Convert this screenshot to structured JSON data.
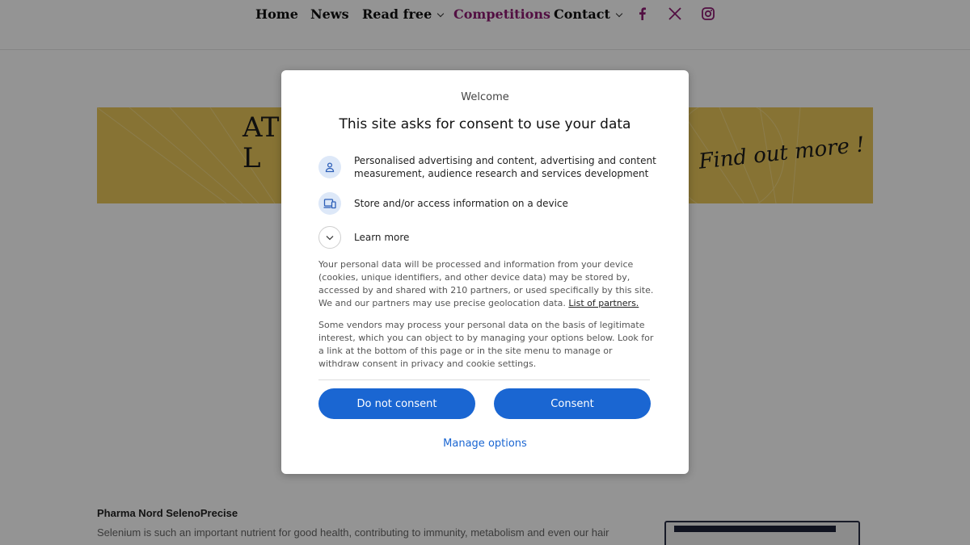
{
  "nav": {
    "items": [
      {
        "label": "Home"
      },
      {
        "label": "News"
      },
      {
        "label": "Read free"
      },
      {
        "label": "Competitions"
      },
      {
        "label": "Contact"
      }
    ],
    "social": [
      "facebook-icon",
      "x-icon",
      "instagram-icon"
    ],
    "active_color": "#8e1a73"
  },
  "banner": {
    "title": "AT\nL",
    "cta": "Find out more !",
    "color": "#e9c65a"
  },
  "article": {
    "title": "Pharma Nord SelenoPrecise",
    "body": "Selenium is such an important nutrient for good health, contributing to immunity, metabolism and even our hair"
  },
  "consent": {
    "welcome": "Welcome",
    "headline": "This site asks for consent to use your data",
    "purposes": [
      {
        "icon": "person-icon",
        "text": "Personalised advertising and content, advertising and content measurement, audience research and services development"
      },
      {
        "icon": "devices-icon",
        "text": "Store and/or access information on a device"
      }
    ],
    "learn_more": "Learn more",
    "para1": "Your personal data will be processed and information from your device (cookies, unique identifiers, and other device data) may be stored by, accessed by and shared with 210 partners, or used specifically by this site. We and our partners may use precise geolocation data.",
    "partners_link": "List of partners.",
    "para2": "Some vendors may process your personal data on the basis of legitimate interest, which you can object to by managing your options below. Look for a link at the bottom of this page or in the site menu to manage or withdraw consent in privacy and cookie settings.",
    "do_not_consent": "Do not consent",
    "consent": "Consent",
    "manage_options": "Manage options",
    "button_color": "#1a66d2"
  }
}
